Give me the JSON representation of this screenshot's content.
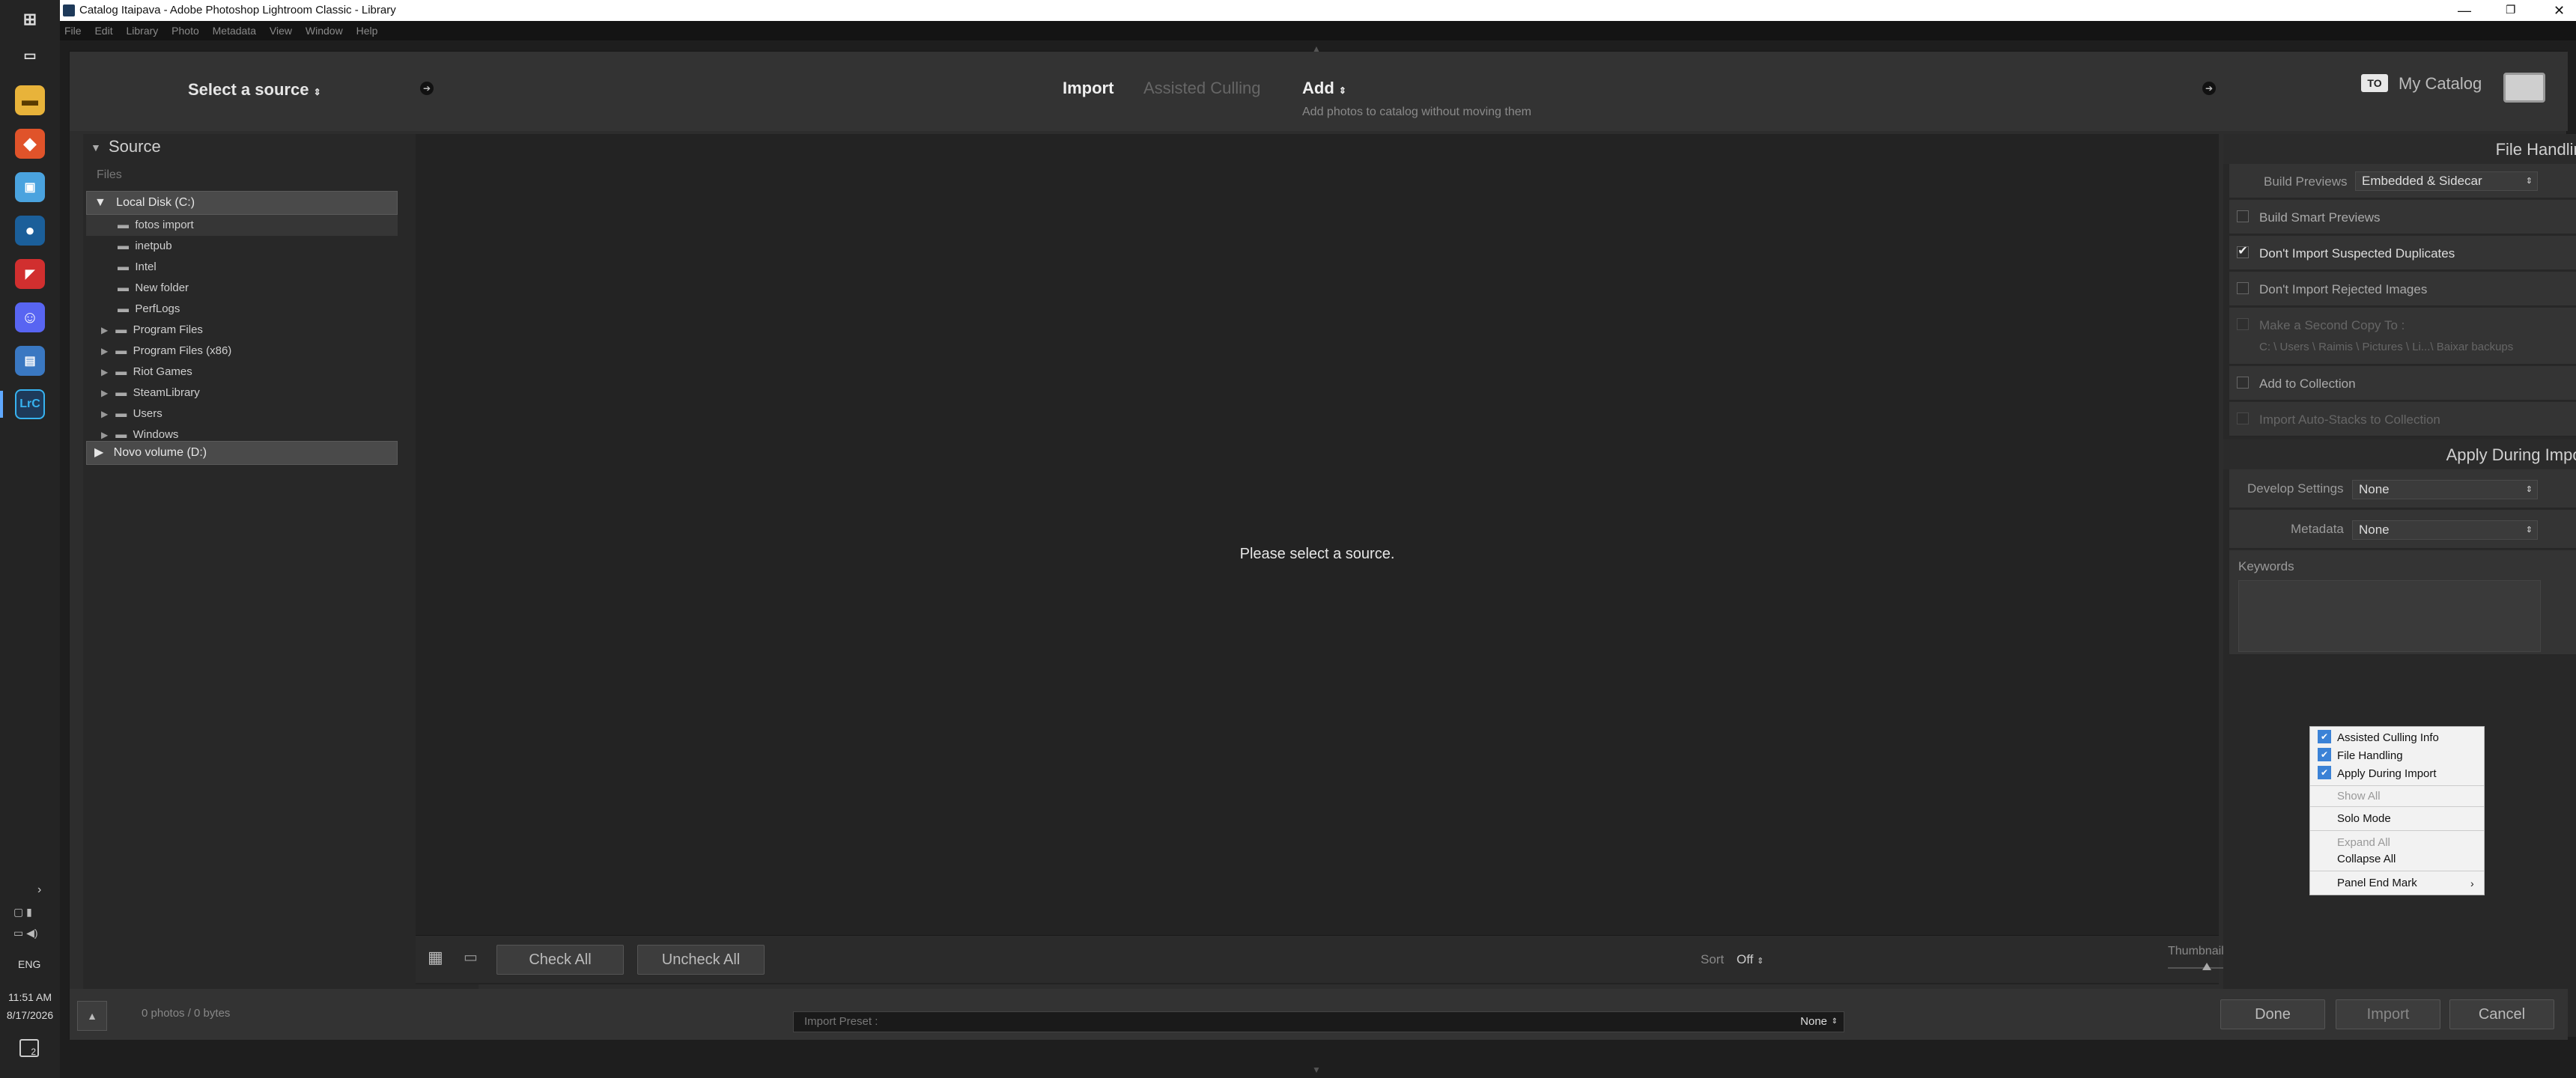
{
  "window": {
    "title": "Catalog Itaipava - Adobe Photoshop Lightroom Classic - Library",
    "app_icon": "LrC"
  },
  "menu": [
    "File",
    "Edit",
    "Library",
    "Photo",
    "Metadata",
    "View",
    "Window",
    "Help"
  ],
  "taskbar": {
    "time": "11:51 AM",
    "date": "8/17/2026",
    "lang": "ENG",
    "notif_count": "2"
  },
  "import": {
    "source_title": "Select a source",
    "modes": {
      "import": "Import",
      "culling": "Assisted Culling",
      "add": "Add",
      "add_desc": "Add photos to catalog without moving them"
    },
    "catalog": {
      "badge": "TO",
      "name": "My Catalog"
    },
    "source_panel": {
      "title": "Source",
      "files_label": "Files",
      "local_disk": "Local Disk (C:)",
      "folders": [
        "fotos import",
        "inetpub",
        "Intel",
        "New folder",
        "PerfLogs",
        "Program Files",
        "Program Files (x86)",
        "Riot Games",
        "SteamLibrary",
        "Users",
        "Windows"
      ],
      "novo": "Novo volume (D:)"
    },
    "center_msg": "Please select a source.",
    "toolbar": {
      "check_all": "Check All",
      "uncheck_all": "Uncheck All",
      "sort_label": "Sort",
      "sort_value": "Off",
      "thumbnails": "Thumbnails"
    },
    "footer": {
      "count": "0 photos / 0 bytes",
      "preset_label": "Import Preset :",
      "preset_value": "None",
      "done": "Done",
      "import_btn": "Import",
      "cancel": "Cancel"
    },
    "file_handling": {
      "title": "File Handling",
      "build_previews_label": "Build Previews",
      "build_previews_value": "Embedded & Sidecar",
      "smart_previews": "Build Smart Previews",
      "no_duplicates": "Don't Import Suspected Duplicates",
      "no_rejected": "Don't Import Rejected Images",
      "second_copy": "Make a Second Copy To :",
      "second_copy_path": "C: \\ Users \\ Raimis \\ Pictures \\ Li...\\ Baixar backups",
      "add_collection": "Add to Collection",
      "auto_stacks": "Import Auto-Stacks to Collection"
    },
    "apply": {
      "title": "Apply During Import",
      "develop_label": "Develop Settings",
      "develop_value": "None",
      "metadata_label": "Metadata",
      "metadata_value": "None",
      "keywords_label": "Keywords"
    },
    "context_menu": {
      "items": [
        "Assisted Culling Info",
        "File Handling",
        "Apply During Import",
        "Show All",
        "Solo Mode",
        "Expand All",
        "Collapse All",
        "Panel End Mark"
      ]
    }
  }
}
